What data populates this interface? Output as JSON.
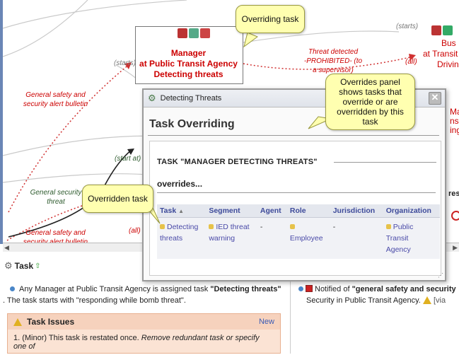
{
  "diagram": {
    "manager_node": [
      "Manager",
      "at Public Transit Agency",
      "Detecting threats"
    ],
    "bus_node": [
      "Bus",
      "at Transit",
      "Drivin"
    ],
    "right_node_fragment": [
      "Mar",
      "ns",
      "ing"
    ],
    "labels": {
      "starts_top_right": "(starts)",
      "starts_left": "(starts)",
      "threat_detected": [
        "Threat detected",
        "-PROHIBITED- (to",
        "a supervisor)"
      ],
      "all_top": "(all)",
      "general_safety_1": [
        "General safety and",
        "security alert bulletin"
      ],
      "general_security_threat": [
        "General security",
        "threat"
      ],
      "general_safety_2": [
        "General safety and",
        "security alert bulletin"
      ],
      "start_at": "(start at)",
      "all_bottom": "(all)",
      "res_fragment": "res"
    }
  },
  "callouts": {
    "overriding": "Overriding task",
    "overrides_panel": [
      "Overrides panel",
      "shows tasks that",
      "override or are",
      "overridden by this",
      "task"
    ],
    "overridden": "Overridden task"
  },
  "dialog": {
    "title": "Detecting Threats",
    "heading": "Task Overriding",
    "section": "TASK \"MANAGER DETECTING THREATS\"",
    "overrides": "overrides...",
    "columns": [
      "Task",
      "Segment",
      "Agent",
      "Role",
      "Jurisdiction",
      "Organization"
    ],
    "rows": [
      {
        "task": [
          "Detecting",
          "threats"
        ],
        "segment": [
          "IED threat",
          "warning"
        ],
        "agent": "-",
        "role": "Employee",
        "jurisdiction": "-",
        "organization": [
          "Public",
          "Transit",
          "Agency"
        ]
      }
    ]
  },
  "task_panel": {
    "title": "Task",
    "assign_prefix": "Any Manager at Public Transit Agency is assigned task ",
    "assign_task": "\"Detecting threats\"",
    "assign_line2": ". The task starts with \"responding while bomb threat\".",
    "issues_title": "Task Issues",
    "issues_new": "New",
    "issue_1_prefix": "1. (Minor) This task is restated once. ",
    "issue_1_italic": "Remove redundant task or specify one of"
  },
  "notification": {
    "prefix": "Notified of ",
    "bold": "\"general safety and security",
    "line2": "Security in Public Transit Agency.",
    "via": "[via"
  }
}
